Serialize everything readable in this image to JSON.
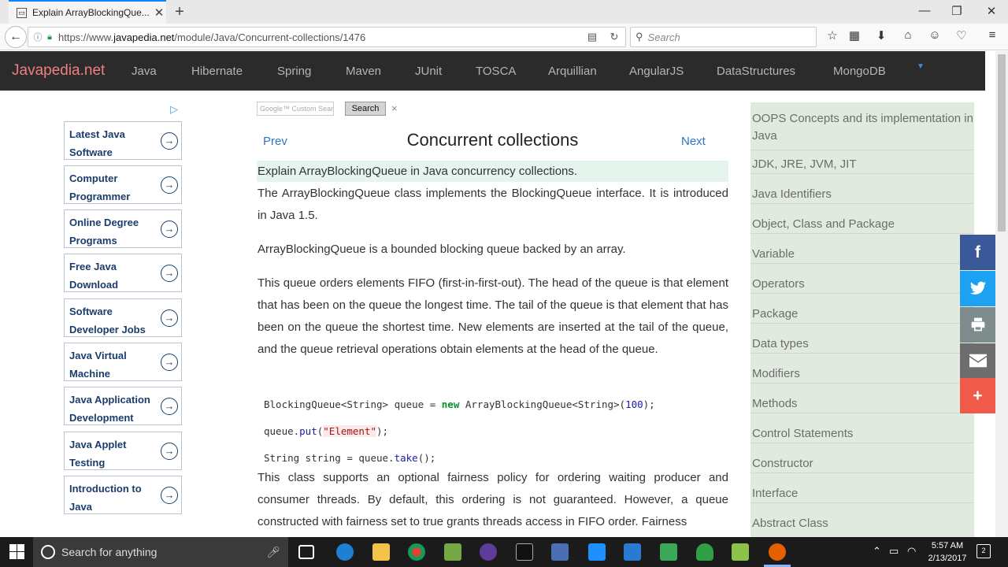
{
  "browser": {
    "tab_title": "Explain ArrayBlockingQue...",
    "tab_icon": "page-icon",
    "url_prefix": "https://www.",
    "url_domain": "javapedia.net",
    "url_path": "/module/Java/Concurrent-collections/1476",
    "search_placeholder": "Search"
  },
  "site": {
    "brand": "Javapedia.net",
    "menu": [
      "Java",
      "Hibernate",
      "Spring",
      "Maven",
      "JUnit",
      "TOSCA",
      "Arquillian",
      "AngularJS",
      "DataStructures",
      "MongoDB"
    ]
  },
  "ads": {
    "choice_icon": "adchoices-icon",
    "links": [
      "Latest Java Software",
      "Computer Programmer",
      "Online Degree Programs",
      "Free Java Download",
      "Software Developer Jobs",
      "Java Virtual Machine",
      "Java Application Development",
      "Java Applet Testing",
      "Introduction to Java"
    ]
  },
  "main": {
    "gsearch_placeholder": "Custom Search",
    "gsearch_logo": "Google™",
    "search_button": "Search",
    "clear": "×",
    "prev": "Prev",
    "next": "Next",
    "title": "Concurrent collections",
    "question": "Explain ArrayBlockingQueue in Java concurrency collections.",
    "para1": "The ArrayBlockingQueue class implements the BlockingQueue interface. It is introduced in Java 1.5.",
    "para2": "ArrayBlockingQueue is a bounded blocking queue backed by an array.",
    "para3": "This queue orders elements FIFO (first-in-first-out). The head of the queue is that element that has been on the queue the longest time. The tail of the queue is that element that has been on the queue the shortest time. New elements are inserted at the tail of the queue, and the queue retrieval operations obtain elements at the head of the queue.",
    "code": {
      "line1_a": "BlockingQueue<String> queue = ",
      "line1_kw": "new",
      "line1_b": " ArrayBlockingQueue<String>(",
      "line1_num": "100",
      "line1_c": ");",
      "line2_a": "queue.",
      "line2_meth": "put",
      "line2_b": "(",
      "line2_str": "\"Element\"",
      "line2_c": ");",
      "line3_a": "String string = queue.",
      "line3_meth": "take",
      "line3_b": "();"
    },
    "para4": "This class supports an optional fairness policy for ordering waiting producer and consumer threads. By default, this ordering is not guaranteed. However, a queue constructed with fairness set to true grants threads access in FIFO order. Fairness"
  },
  "sidebar": {
    "links": [
      "OOPS Concepts and its implementation in Java",
      "JDK, JRE, JVM, JIT",
      "Java Identifiers",
      "Object, Class and Package",
      "Variable",
      "Operators",
      "Package",
      "Data types",
      "Modifiers",
      "Methods",
      "Control Statements",
      "Constructor",
      "Interface",
      "Abstract Class"
    ]
  },
  "share": {
    "colors": [
      "#3b5998",
      "#1da1f2",
      "#7f8c8d",
      "#6d6d6d",
      "#f05a4a"
    ],
    "icons": [
      "facebook-icon",
      "twitter-icon",
      "print-icon",
      "email-icon",
      "plus-icon"
    ]
  },
  "taskbar": {
    "search_placeholder": "Search for anything",
    "time": "5:57 AM",
    "date": "2/13/2017"
  }
}
